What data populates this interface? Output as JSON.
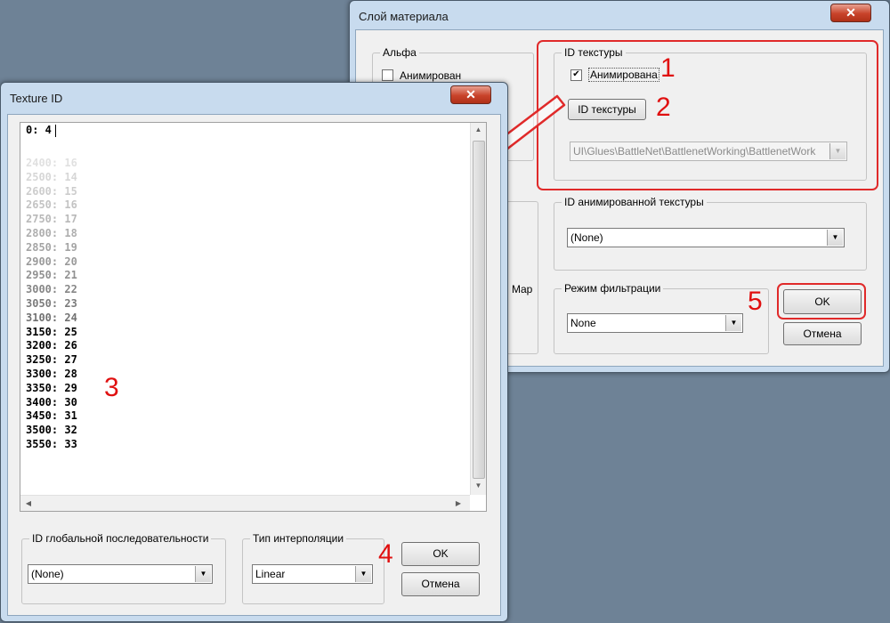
{
  "material_dialog": {
    "title": "Слой материала",
    "close_glyph": "✕",
    "alpha_group": {
      "label": "Альфа",
      "animated_label": "Анимирован"
    },
    "texture_id_group": {
      "label": "ID текстуры",
      "animated_label": "Анимирована",
      "animated_checked": "✔",
      "texture_id_button": "ID текстуры",
      "path_value": "UI\\Glues\\BattleNet\\BattlenetWorking\\BattlenetWork"
    },
    "animated_texture_group": {
      "label": "ID анимированной текстуры",
      "selected": "(None)"
    },
    "filter_group": {
      "label": "Режим фильтрации",
      "selected": "None"
    },
    "partial_text": "Map",
    "ok_button": "OK",
    "cancel_button": "Отмена"
  },
  "texture_dialog": {
    "title": "Texture ID",
    "close_glyph": "✕",
    "first_line": "0: 4",
    "faded_lines": [
      "2400: 16",
      "2500: 14",
      "2600: 15",
      "2650: 16",
      "2750: 17",
      "2800: 18",
      "2850: 19",
      "2900: 20",
      "2950: 21",
      "3000: 22",
      "3050: 23",
      "3100: 24"
    ],
    "lines": [
      "3150: 25",
      "3200: 26",
      "3250: 27",
      "3300: 28",
      "3350: 29",
      "3400: 30",
      "3450: 31",
      "3500: 32",
      "3550: 33"
    ],
    "global_seq_group": {
      "label": "ID глобальной последовательности",
      "selected": "(None)"
    },
    "interp_group": {
      "label": "Тип интерполяции",
      "selected": "Linear"
    },
    "ok_button": "OK",
    "cancel_button": "Отмена"
  },
  "annotations": [
    "1",
    "2",
    "3",
    "4",
    "5"
  ],
  "colors": {
    "annotation": "#e01010",
    "desktop": "#6e8296",
    "window_frame": "#c8dbee"
  },
  "icons": {
    "dropdown": "▼",
    "scroll_up": "▲",
    "scroll_down": "▼",
    "scroll_left": "◀",
    "scroll_right": "▶"
  }
}
